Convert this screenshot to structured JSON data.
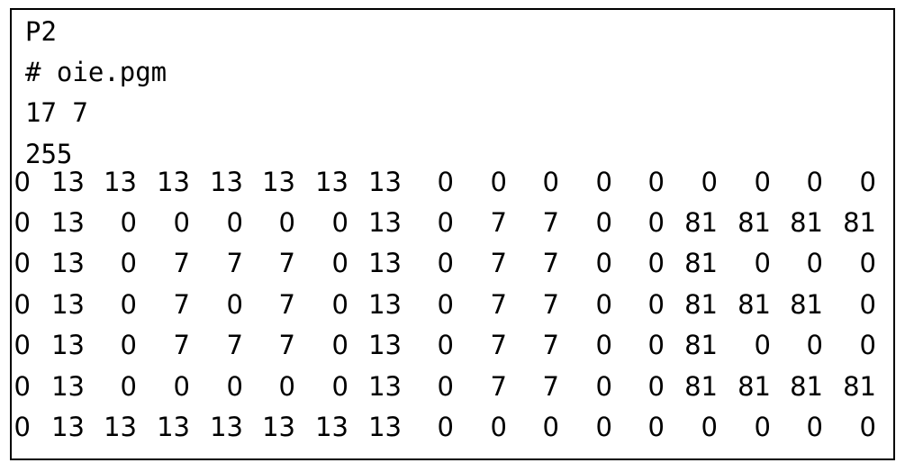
{
  "header": {
    "magic": "P2",
    "comment": "# oie.pgm",
    "dimensions": "17 7",
    "maxval": "255"
  },
  "pixels": [
    [
      "0",
      "13",
      "13",
      "13",
      "13",
      "13",
      "13",
      "13",
      "0",
      "0",
      "0",
      "0",
      "0",
      "0",
      "0",
      "0",
      "0"
    ],
    [
      "0",
      "13",
      "0",
      "0",
      "0",
      "0",
      "0",
      "13",
      "0",
      "7",
      "7",
      "0",
      "0",
      "81",
      "81",
      "81",
      "81"
    ],
    [
      "0",
      "13",
      "0",
      "7",
      "7",
      "7",
      "0",
      "13",
      "0",
      "7",
      "7",
      "0",
      "0",
      "81",
      "0",
      "0",
      "0"
    ],
    [
      "0",
      "13",
      "0",
      "7",
      "0",
      "7",
      "0",
      "13",
      "0",
      "7",
      "7",
      "0",
      "0",
      "81",
      "81",
      "81",
      "0"
    ],
    [
      "0",
      "13",
      "0",
      "7",
      "7",
      "7",
      "0",
      "13",
      "0",
      "7",
      "7",
      "0",
      "0",
      "81",
      "0",
      "0",
      "0"
    ],
    [
      "0",
      "13",
      "0",
      "0",
      "0",
      "0",
      "0",
      "13",
      "0",
      "7",
      "7",
      "0",
      "0",
      "81",
      "81",
      "81",
      "81"
    ],
    [
      "0",
      "13",
      "13",
      "13",
      "13",
      "13",
      "13",
      "13",
      "0",
      "0",
      "0",
      "0",
      "0",
      "0",
      "0",
      "0",
      "0"
    ]
  ]
}
